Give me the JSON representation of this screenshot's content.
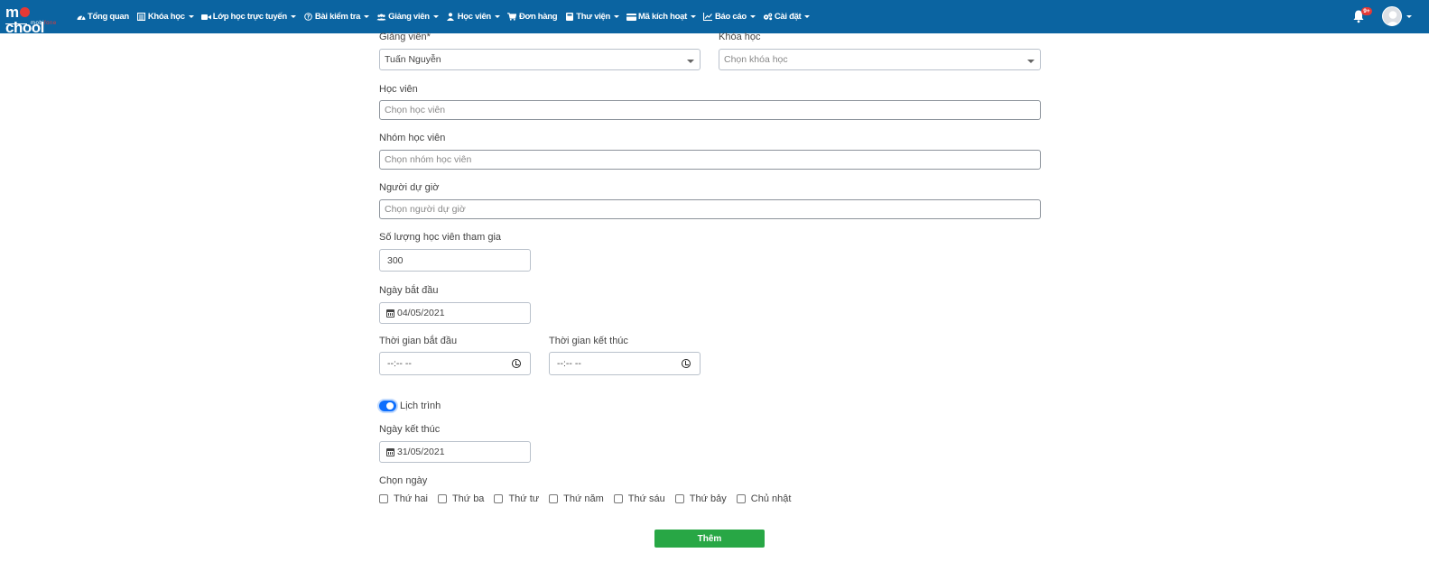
{
  "navbar": {
    "logo_text": "mschool",
    "logo_sub": "mobifone",
    "items": [
      {
        "label": "Tổng quan",
        "icon": "dashboard-icon",
        "dropdown": false
      },
      {
        "label": "Khóa học",
        "icon": "book-icon",
        "dropdown": true
      },
      {
        "label": "Lớp học trực tuyến",
        "icon": "video-icon",
        "dropdown": true
      },
      {
        "label": "Bài kiểm tra",
        "icon": "question-circle-icon",
        "dropdown": true
      },
      {
        "label": "Giảng viên",
        "icon": "users-icon",
        "dropdown": true
      },
      {
        "label": "Học viên",
        "icon": "user-icon",
        "dropdown": true
      },
      {
        "label": "Đơn hàng",
        "icon": "cart-icon",
        "dropdown": false
      },
      {
        "label": "Thư viện",
        "icon": "library-icon",
        "dropdown": true
      },
      {
        "label": "Mã kích hoạt",
        "icon": "credit-card-icon",
        "dropdown": true
      },
      {
        "label": "Báo cáo",
        "icon": "chart-icon",
        "dropdown": true
      },
      {
        "label": "Cài đặt",
        "icon": "cogs-icon",
        "dropdown": true
      }
    ],
    "notification_count": "9+",
    "colors": {
      "navbar_bg": "#0b64a1",
      "badge": "#e53935"
    }
  },
  "form": {
    "teacher_label": "Giảng viên*",
    "teacher_value": "Tuấn Nguyễn",
    "course_label": "Khóa học",
    "course_placeholder": "Chọn khóa học",
    "students_label": "Học viên",
    "students_placeholder": "Chọn học viên",
    "student_groups_label": "Nhóm học viên",
    "student_groups_placeholder": "Chọn nhóm học viên",
    "observers_label": "Người dự giờ",
    "observers_placeholder": "Chọn người dự giờ",
    "participants_label": "Số lượng học viên tham gia",
    "participants_value": "300",
    "start_date_label": "Ngày bắt đầu",
    "start_date_value": "04/05/2021",
    "start_time_label": "Thời gian bắt đầu",
    "start_time_value": "--:-- --",
    "end_time_label": "Thời gian kết thúc",
    "end_time_value": "--:-- --",
    "schedule_label": "Lịch trình",
    "schedule_enabled": true,
    "end_date_label": "Ngày kết thúc",
    "end_date_value": "31/05/2021",
    "choose_days_label": "Chọn ngày",
    "days": [
      "Thứ hai",
      "Thứ ba",
      "Thứ tư",
      "Thứ năm",
      "Thứ sáu",
      "Thứ bảy",
      "Chủ nhật"
    ],
    "submit_label": "Thêm",
    "colors": {
      "switch_on": "#0d6efd",
      "submit_bg": "#28a745"
    }
  }
}
